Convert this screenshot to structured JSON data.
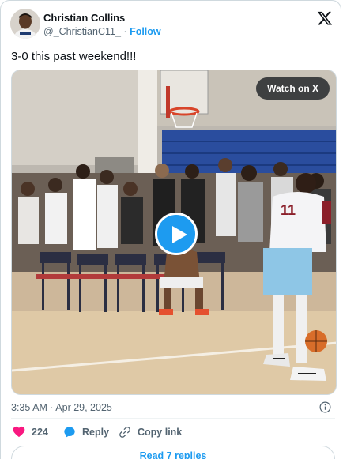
{
  "author": {
    "name": "Christian Collins",
    "handle": "@_ChristianC11_",
    "separator": "·",
    "follow_label": "Follow"
  },
  "tweet": {
    "text": "3-0 this past weekend!!!",
    "timestamp": "3:35 AM · Apr 29, 2025"
  },
  "media": {
    "watch_label": "Watch on X",
    "player_jersey_number": "11"
  },
  "actions": {
    "likes_count": "224",
    "reply_label": "Reply",
    "copy_link_label": "Copy link"
  },
  "footer": {
    "read_replies_label": "Read 7 replies"
  },
  "colors": {
    "accent": "#1d9bf0",
    "like": "#f91880",
    "muted": "#536471"
  },
  "icons": [
    "x-logo-icon",
    "play-icon",
    "info-icon",
    "heart-icon",
    "reply-bubble-icon",
    "link-icon"
  ]
}
